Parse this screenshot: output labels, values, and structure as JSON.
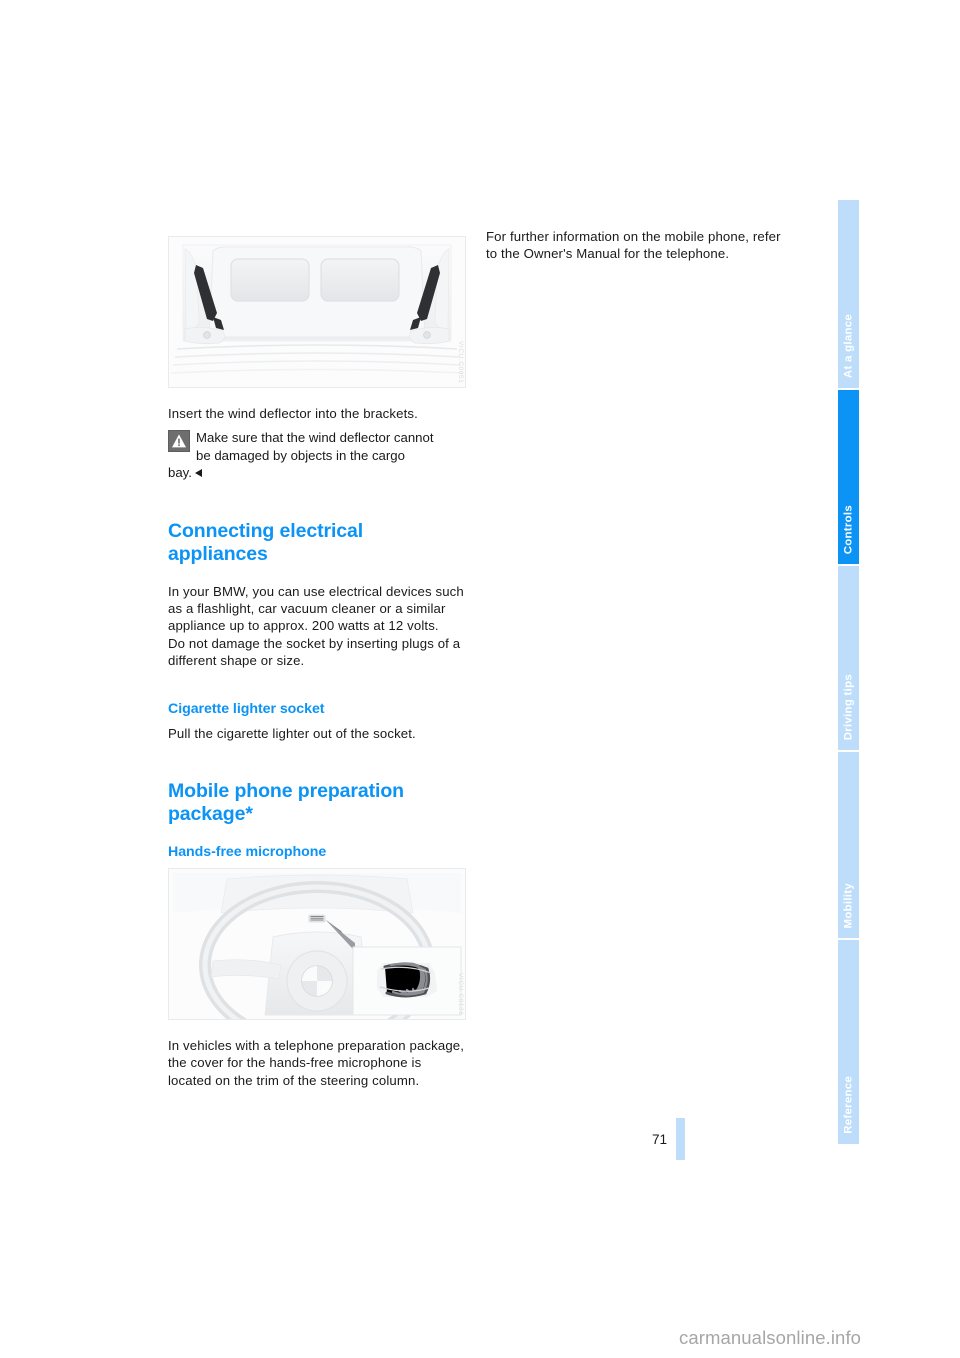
{
  "document": {
    "page_number": "71",
    "watermark": "carmanualsonline.info"
  },
  "left_column": {
    "figure_cargo": {
      "alt": "wind-deflector-brackets-in-cargo-bay",
      "code": "VICU.C0051"
    },
    "instruction": "Insert the wind deflector into the brackets.",
    "warning": {
      "icon": "warning-triangle-icon",
      "line1": "Make sure that the wind deflector cannot",
      "line2": "be damaged by objects in the cargo",
      "tail": "bay."
    },
    "heading_connecting": "Connecting electrical appliances",
    "paragraph_1": "In your BMW, you can use electrical devices such as a flashlight, car vacuum cleaner or a similar appliance up to approx. 200 watts at 12 volts.",
    "paragraph_2": "Do not damage the socket by inserting plugs of a different shape or size.",
    "subheading_cigarette": "Cigarette lighter socket",
    "paragraph_3": "Pull the cigarette lighter out of the socket.",
    "heading_mobile": "Mobile phone preparation package*",
    "subheading_handsfree": "Hands-free microphone",
    "figure_steering": {
      "alt": "hands-free-microphone-on-steering-column",
      "code": "VICU.C0136"
    },
    "paragraph_4": "In vehicles with a telephone preparation package, the cover for the hands-free microphone is located on the trim of the steering column."
  },
  "right_column": {
    "paragraph_1": "For further information on the mobile phone, refer to the Owner's Manual for the telephone."
  },
  "sidebar": {
    "tabs": [
      {
        "label": "At a glance",
        "active": false
      },
      {
        "label": "Controls",
        "active": true
      },
      {
        "label": "Driving tips",
        "active": false
      },
      {
        "label": "Mobility",
        "active": false
      },
      {
        "label": "Reference",
        "active": false
      }
    ]
  },
  "colors": {
    "accent_blue": "#0b93f6",
    "tab_inactive": "#bdddfb",
    "text": "#1a1a1a",
    "watermark": "#a6a6a6"
  }
}
